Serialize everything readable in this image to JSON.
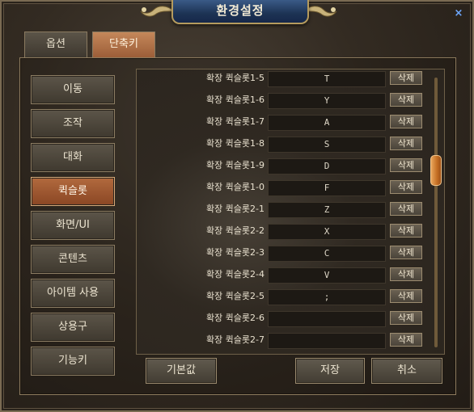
{
  "window": {
    "title": "환경설정",
    "close_symbol": "×"
  },
  "tabs": [
    {
      "label": "옵션",
      "active": false
    },
    {
      "label": "단축키",
      "active": true
    }
  ],
  "categories": [
    {
      "label": "이동",
      "active": false
    },
    {
      "label": "조작",
      "active": false
    },
    {
      "label": "대화",
      "active": false
    },
    {
      "label": "퀵슬롯",
      "active": true
    },
    {
      "label": "화면/UI",
      "active": false
    },
    {
      "label": "콘텐츠",
      "active": false
    },
    {
      "label": "아이템 사용",
      "active": false
    },
    {
      "label": "상용구",
      "active": false
    },
    {
      "label": "기능키",
      "active": false
    }
  ],
  "shortcuts": [
    {
      "label": "확장 퀵슬롯1-5",
      "key": "T",
      "delete_label": "삭제"
    },
    {
      "label": "확장 퀵슬롯1-6",
      "key": "Y",
      "delete_label": "삭제"
    },
    {
      "label": "확장 퀵슬롯1-7",
      "key": "A",
      "delete_label": "삭제"
    },
    {
      "label": "확장 퀵슬롯1-8",
      "key": "S",
      "delete_label": "삭제"
    },
    {
      "label": "확장 퀵슬롯1-9",
      "key": "D",
      "delete_label": "삭제"
    },
    {
      "label": "확장 퀵슬롯1-0",
      "key": "F",
      "delete_label": "삭제"
    },
    {
      "label": "확장 퀵슬롯2-1",
      "key": "Z",
      "delete_label": "삭제"
    },
    {
      "label": "확장 퀵슬롯2-2",
      "key": "X",
      "delete_label": "삭제"
    },
    {
      "label": "확장 퀵슬롯2-3",
      "key": "C",
      "delete_label": "삭제"
    },
    {
      "label": "확장 퀵슬롯2-4",
      "key": "V",
      "delete_label": "삭제"
    },
    {
      "label": "확장 퀵슬롯2-5",
      "key": ";",
      "delete_label": "삭제"
    },
    {
      "label": "확장 퀵슬롯2-6",
      "key": "",
      "delete_label": "삭제"
    },
    {
      "label": "확장 퀵슬롯2-7",
      "key": "",
      "delete_label": "삭제"
    }
  ],
  "buttons": {
    "default_label": "기본값",
    "save_label": "저장",
    "cancel_label": "취소"
  },
  "scroll": {
    "position_fraction": 0.33
  },
  "colors": {
    "accent_active": "#b26a3e",
    "title_plaque": "#1d3354",
    "scroll_thumb": "#e9a65c"
  },
  "icons": {
    "close": "close-icon",
    "ornament": "ornament-icon"
  }
}
